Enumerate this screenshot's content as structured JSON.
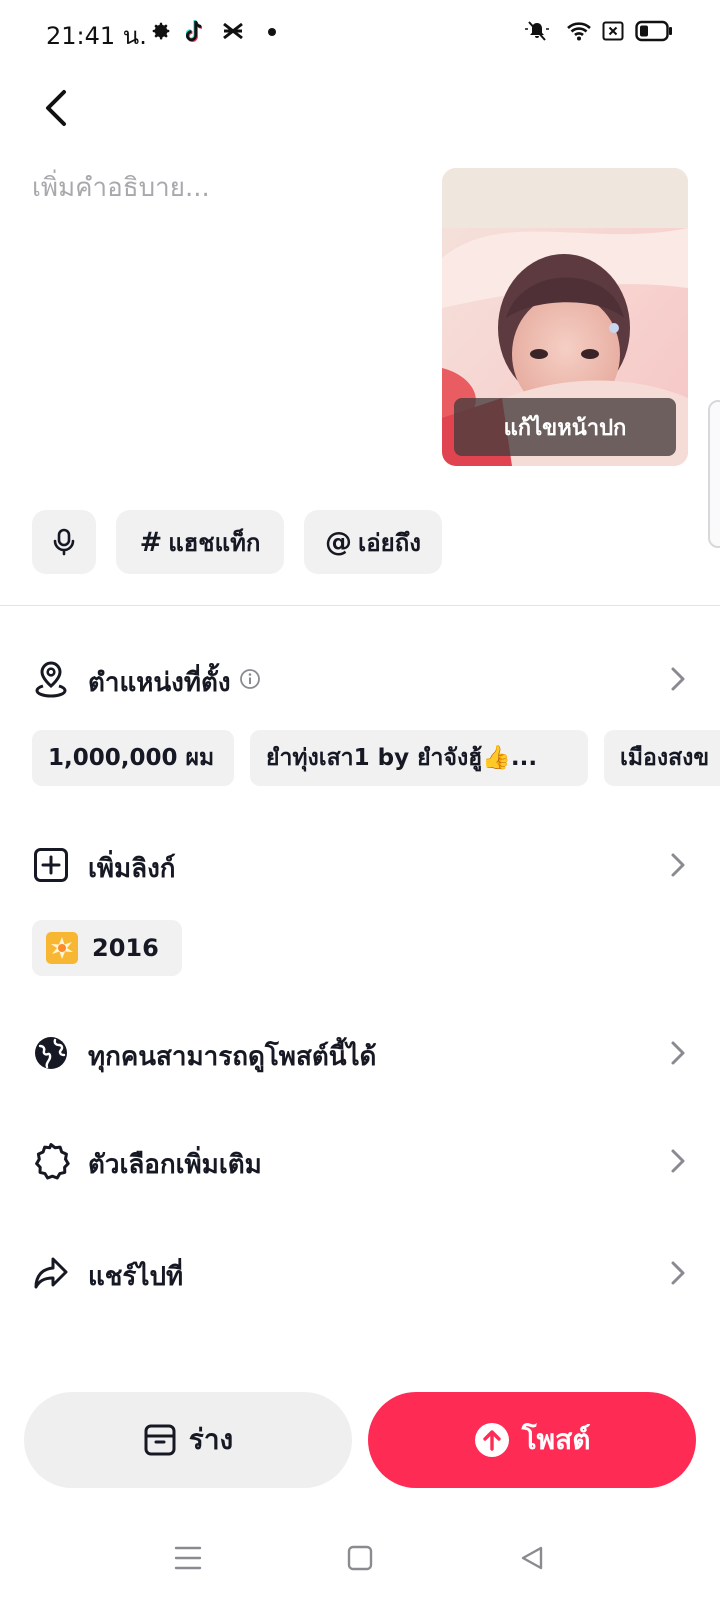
{
  "status_bar": {
    "time": "21:41 น.",
    "icons": [
      "gear-icon",
      "tiktok-icon",
      "capcut-icon",
      "notification-dot",
      "mute-icon",
      "wifi-icon",
      "no-sim-icon",
      "battery-icon"
    ]
  },
  "caption": {
    "placeholder": "เพิ่มคำอธิบาย...",
    "value": ""
  },
  "cover": {
    "edit_label": "แก้ไขหน้าปก"
  },
  "tools": {
    "hashtag_symbol": "#",
    "hashtag_label": "แฮชแท็ก",
    "mention_symbol": "@",
    "mention_label": "เอ่ยถึง"
  },
  "location": {
    "label": "ตำแหน่งที่ตั้ง",
    "suggestions": [
      "1,000,000 ผม",
      "ยำทุ่งเสา1 by ยำจังฮู้👍...",
      "เมืองสงข"
    ]
  },
  "add_link": {
    "label": "เพิ่มลิงก์",
    "suggestion": "2016"
  },
  "privacy": {
    "label": "ทุกคนสามารถดูโพสต์นี้ได้"
  },
  "more_options": {
    "label": "ตัวเลือกเพิ่มเติม"
  },
  "share_to": {
    "label": "แชร์ไปที่"
  },
  "actions": {
    "draft_label": "ร่าง",
    "post_label": "โพสต์"
  },
  "colors": {
    "accent": "#fe2c55",
    "chip_bg": "#f1f1f2",
    "text": "#161823",
    "placeholder": "#a8a8ad"
  }
}
